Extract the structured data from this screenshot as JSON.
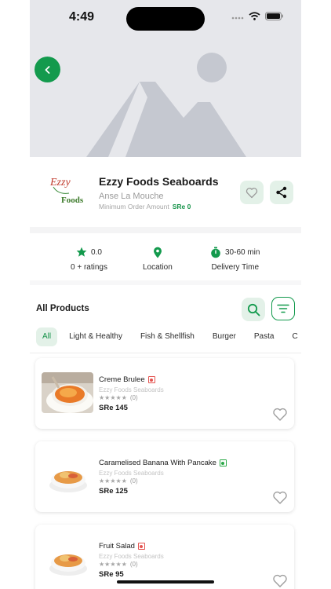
{
  "status_bar": {
    "time": "4:49"
  },
  "store": {
    "logo_text_top": "Ezzy",
    "logo_text_bottom": "Foods",
    "name": "Ezzy Foods Seaboards",
    "location": "Anse La Mouche",
    "min_order_label": "Minimum Order Amount",
    "min_order_value": "SRe 0"
  },
  "info": {
    "rating_value": "0.0",
    "rating_count": "0 + ratings",
    "location_label": "Location",
    "delivery_time_value": "30-60 min",
    "delivery_time_label": "Delivery Time"
  },
  "products_header": {
    "title": "All Products"
  },
  "categories": [
    "All",
    "Light & Healthy",
    "Fish & Shellfish",
    "Burger",
    "Pasta",
    "C"
  ],
  "products": [
    {
      "name": "Creme Brulee",
      "store": "Ezzy Foods Seaboards",
      "rating": "(0)",
      "price": "SRe 145",
      "diet": "non-veg"
    },
    {
      "name": "Caramelised Banana With Pancake",
      "store": "Ezzy Foods Seaboards",
      "rating": "(0)",
      "price": "SRe 125",
      "diet": "veg"
    },
    {
      "name": "Fruit Salad",
      "store": "Ezzy Foods Seaboards",
      "rating": "(0)",
      "price": "SRe 95",
      "diet": "non-veg"
    }
  ],
  "colors": {
    "accent": "#139a4d",
    "accent_light": "#e3f1e8",
    "non_veg": "#e4534f",
    "veg": "#2aa847"
  },
  "icons": [
    "back-arrow-icon",
    "heart-icon",
    "share-icon",
    "star-icon",
    "location-pin-icon",
    "timer-icon",
    "search-icon",
    "filter-icon"
  ]
}
